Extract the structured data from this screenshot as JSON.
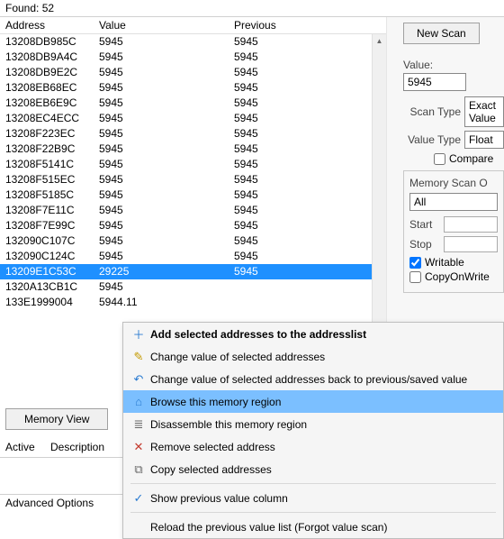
{
  "found_label": "Found:",
  "found_count": "52",
  "headers": {
    "address": "Address",
    "value": "Value",
    "previous": "Previous"
  },
  "rows": [
    {
      "addr": "13208DB985C",
      "val": "5945",
      "prev": "5945",
      "sel": false
    },
    {
      "addr": "13208DB9A4C",
      "val": "5945",
      "prev": "5945",
      "sel": false
    },
    {
      "addr": "13208DB9E2C",
      "val": "5945",
      "prev": "5945",
      "sel": false
    },
    {
      "addr": "13208EB68EC",
      "val": "5945",
      "prev": "5945",
      "sel": false
    },
    {
      "addr": "13208EB6E9C",
      "val": "5945",
      "prev": "5945",
      "sel": false
    },
    {
      "addr": "13208EC4ECC",
      "val": "5945",
      "prev": "5945",
      "sel": false
    },
    {
      "addr": "13208F223EC",
      "val": "5945",
      "prev": "5945",
      "sel": false
    },
    {
      "addr": "13208F22B9C",
      "val": "5945",
      "prev": "5945",
      "sel": false
    },
    {
      "addr": "13208F5141C",
      "val": "5945",
      "prev": "5945",
      "sel": false
    },
    {
      "addr": "13208F515EC",
      "val": "5945",
      "prev": "5945",
      "sel": false
    },
    {
      "addr": "13208F5185C",
      "val": "5945",
      "prev": "5945",
      "sel": false
    },
    {
      "addr": "13208F7E11C",
      "val": "5945",
      "prev": "5945",
      "sel": false
    },
    {
      "addr": "13208F7E99C",
      "val": "5945",
      "prev": "5945",
      "sel": false
    },
    {
      "addr": "132090C107C",
      "val": "5945",
      "prev": "5945",
      "sel": false
    },
    {
      "addr": "132090C124C",
      "val": "5945",
      "prev": "5945",
      "sel": false
    },
    {
      "addr": "13209E1C53C",
      "val": "29225",
      "prev": "5945",
      "sel": true
    },
    {
      "addr": "1320A13CB1C",
      "val": "5945",
      "prev": "",
      "sel": false
    },
    {
      "addr": "133E1999004",
      "val": "5944.11",
      "prev": "",
      "sel": false
    }
  ],
  "right": {
    "new_scan": "New Scan",
    "value_label": "Value:",
    "value_field": "5945",
    "scan_type_label": "Scan Type",
    "scan_type": "Exact Value",
    "value_type_label": "Value Type",
    "value_type": "Float",
    "compare": "Compare",
    "group_title": "Memory Scan O",
    "all": "All",
    "start": "Start",
    "stop": "Stop",
    "writable": "Writable",
    "cow": "CopyOnWrite"
  },
  "memview": "Memory View",
  "opts_active": "Active",
  "opts_desc": "Description",
  "advanced": "Advanced Options",
  "ctx": {
    "add": "Add selected addresses to the addresslist",
    "change": "Change value of selected addresses",
    "revert": "Change value of selected addresses back to previous/saved value",
    "browse": "Browse this memory region",
    "disasm": "Disassemble this memory region",
    "remove": "Remove selected address",
    "copy": "Copy selected addresses",
    "showprev": "Show previous value column",
    "reload": "Reload the previous value list (Forgot value scan)"
  },
  "icons": {
    "plus": "＋",
    "pencil": "✎",
    "undo": "↶",
    "browse": "⌂",
    "disasm": "≣",
    "remove": "✕",
    "copy": "⧉",
    "check": "✓"
  }
}
